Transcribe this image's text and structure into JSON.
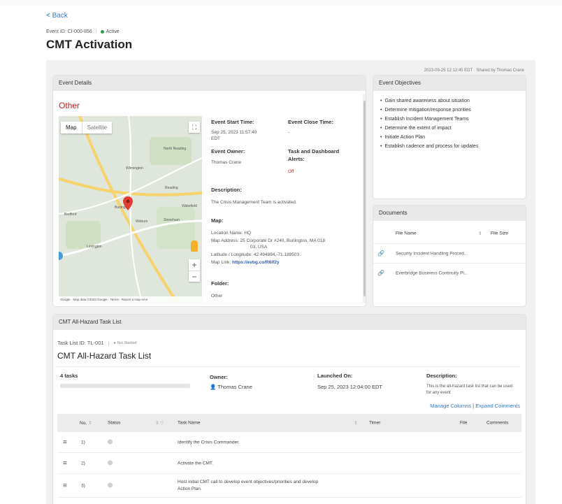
{
  "back": "< Back",
  "event_meta": {
    "event_id": "Event ID: CI-000-856",
    "status": "Active"
  },
  "page_title": "CMT Activation",
  "shared_info": "2023-09-25 12:12:45 EDT · Shared by Thomas Crane",
  "event_details": {
    "header": "Event Details",
    "event_type": "Other",
    "map": {
      "tab_map": "Map",
      "tab_satellite": "Satellite",
      "footer": "Google · Map data ©2023 Google · Terms · Report a map error",
      "places": [
        "North Reading",
        "Wilmington",
        "Reading",
        "Woburn",
        "Stoneham",
        "Lexington",
        "Burlington",
        "Bedford",
        "Wakefield"
      ]
    },
    "start_time_label": "Event Start Time:",
    "start_time_value_1": "Sep 25, 2023 11:57:40",
    "start_time_value_2": "EDT",
    "close_time_label": "Event Close Time:",
    "close_time_value": "-",
    "owner_label": "Event Owner:",
    "owner_value": "Thomas Crane",
    "alerts_label_1": "Task and Dashboard",
    "alerts_label_2": "Alerts:",
    "alerts_value": "Off",
    "description_label": "Description:",
    "description_value": "The Crisis Management Team is activated.",
    "map_label": "Map:",
    "location_name": "Location Name: HQ",
    "map_address_1": "Map Address: 25 Corporate Dr #240, Burlington, MA 018",
    "map_address_2": "03, USA",
    "lat_long": "Latitude / Longitude: 42.494884,-71.189503",
    "map_link_label": "Map Link:",
    "map_link_value": "https://evbg.co/R6if2y",
    "folder_label": "Folder:",
    "folder_value": "Other"
  },
  "objectives": {
    "header": "Event Objectives",
    "items": [
      "Gain shared awareness about situation",
      "Determine mitigation/response priorities",
      "Establish Incident Management Teams",
      "Determine the extent of impact",
      "Initiate Action Plan",
      "Establish cadence and process for updates"
    ]
  },
  "documents": {
    "header": "Documents",
    "col_name": "File Name",
    "col_size": "File Size",
    "sort_glyph": "⇕",
    "files": [
      {
        "name": "Security Incident Handling Proced..."
      },
      {
        "name": "Everbridge Business Continuity Pl..."
      }
    ]
  },
  "task_list": {
    "header": "CMT All-Hazard Task List",
    "id": "Task List ID: TL-001",
    "status": "Not Started",
    "title": "CMT All-Hazard Task List",
    "tasks_count": "4 tasks",
    "progress_fraction": 0.0,
    "owner_label": "Owner:",
    "owner_value": "Thomas Crane",
    "launched_label": "Launched On:",
    "launched_value": "Sep 25, 2023 12:04:00 EDT",
    "desc_label": "Description:",
    "desc_value": "This is the all-hazard task list that can be used for any event",
    "manage_columns": "Manage Columns",
    "separator": "|",
    "expand_comments": "Expand Comments",
    "columns": {
      "no": "No.",
      "status": "Status",
      "task_name": "Task Name",
      "timer": "Timer",
      "file": "File",
      "comments": "Comments"
    },
    "rows": [
      {
        "no": "1)",
        "task": "Identify the Crisis Commander."
      },
      {
        "no": "2)",
        "task": "Activate the CMT."
      },
      {
        "no": "3)",
        "task": "Host initial CMT call to develop event objectives/priorities and develop",
        "task2": "Action Plan."
      }
    ]
  },
  "colors": {
    "accent": "#3a78c8",
    "active": "#2e9b48",
    "event_type": "#c32020",
    "header_bg": "#e9e9e9"
  }
}
